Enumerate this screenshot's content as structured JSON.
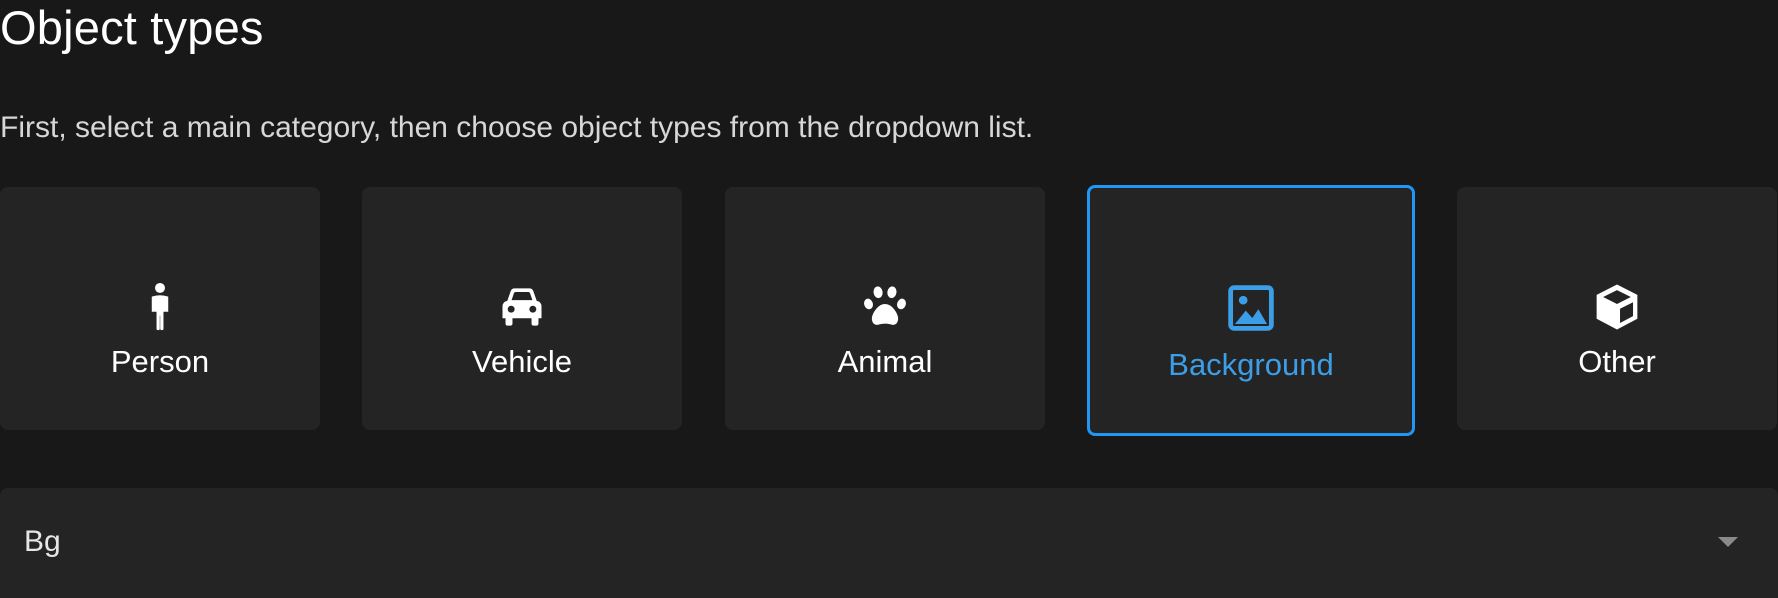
{
  "header": {
    "title": "Object types",
    "instruction": "First, select a main category, then choose object types from the dropdown list."
  },
  "categories": [
    {
      "label": "Person",
      "icon": "person-icon",
      "selected": false
    },
    {
      "label": "Vehicle",
      "icon": "car-icon",
      "selected": false
    },
    {
      "label": "Animal",
      "icon": "paw-icon",
      "selected": false
    },
    {
      "label": "Background",
      "icon": "image-icon",
      "selected": true
    },
    {
      "label": "Other",
      "icon": "cube-icon",
      "selected": false
    }
  ],
  "dropdown": {
    "value": "Bg",
    "icon": "chevron-down-icon"
  },
  "colors": {
    "background": "#181818",
    "card": "#242424",
    "accent": "#2196f3",
    "accent_text": "#3c9ee6"
  }
}
